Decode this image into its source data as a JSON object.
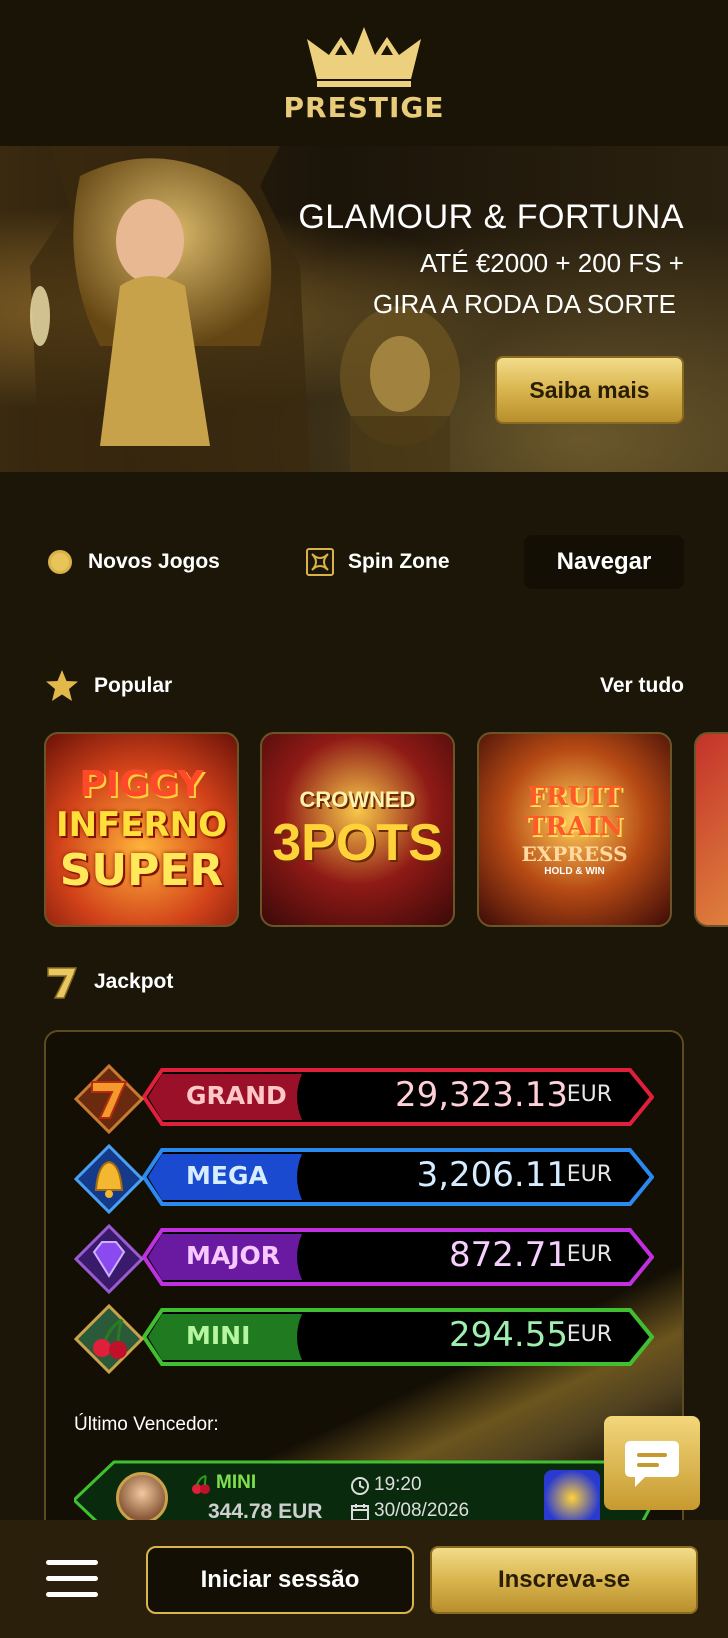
{
  "header": {
    "logo_text": "PRESTIGE"
  },
  "hero": {
    "title": "GLAMOUR & FORTUNA",
    "line1": "ATÉ €2000 + 200 FS +",
    "line2": "GIRA A RODA DA SORTE",
    "cta": "Saiba mais"
  },
  "nav": {
    "new_games": "Novos Jogos",
    "spin_zone": "Spin Zone",
    "browse": "Navegar"
  },
  "popular": {
    "title": "Popular",
    "see_all": "Ver tudo",
    "games": [
      {
        "line1": "PIGGY",
        "line2": "INFERNO",
        "line3": "SUPER"
      },
      {
        "line1": "CROWNED",
        "line2": "3POTS"
      },
      {
        "line1": "FRUIT TRAIN",
        "line2": "EXPRESS",
        "line3": "HOLD & WIN"
      }
    ]
  },
  "jackpot": {
    "title": "Jackpot",
    "tiers": [
      {
        "label": "GRAND",
        "value": "29,323.13",
        "currency": "EUR",
        "color": "#e0203a"
      },
      {
        "label": "MEGA",
        "value": "3,206.11",
        "currency": "EUR",
        "color": "#2a8af0"
      },
      {
        "label": "MAJOR",
        "value": "872.71",
        "currency": "EUR",
        "color": "#c030e0"
      },
      {
        "label": "MINI",
        "value": "294.55",
        "currency": "EUR",
        "color": "#40c030"
      }
    ],
    "last_winner_label": "Último Vencedor:",
    "last_winner": {
      "tier": "MINI",
      "amount": "344.78 EUR",
      "time": "19:20",
      "date": "30/08/2026"
    }
  },
  "bottom": {
    "login": "Iniciar sessão",
    "signup": "Inscreva-se"
  }
}
